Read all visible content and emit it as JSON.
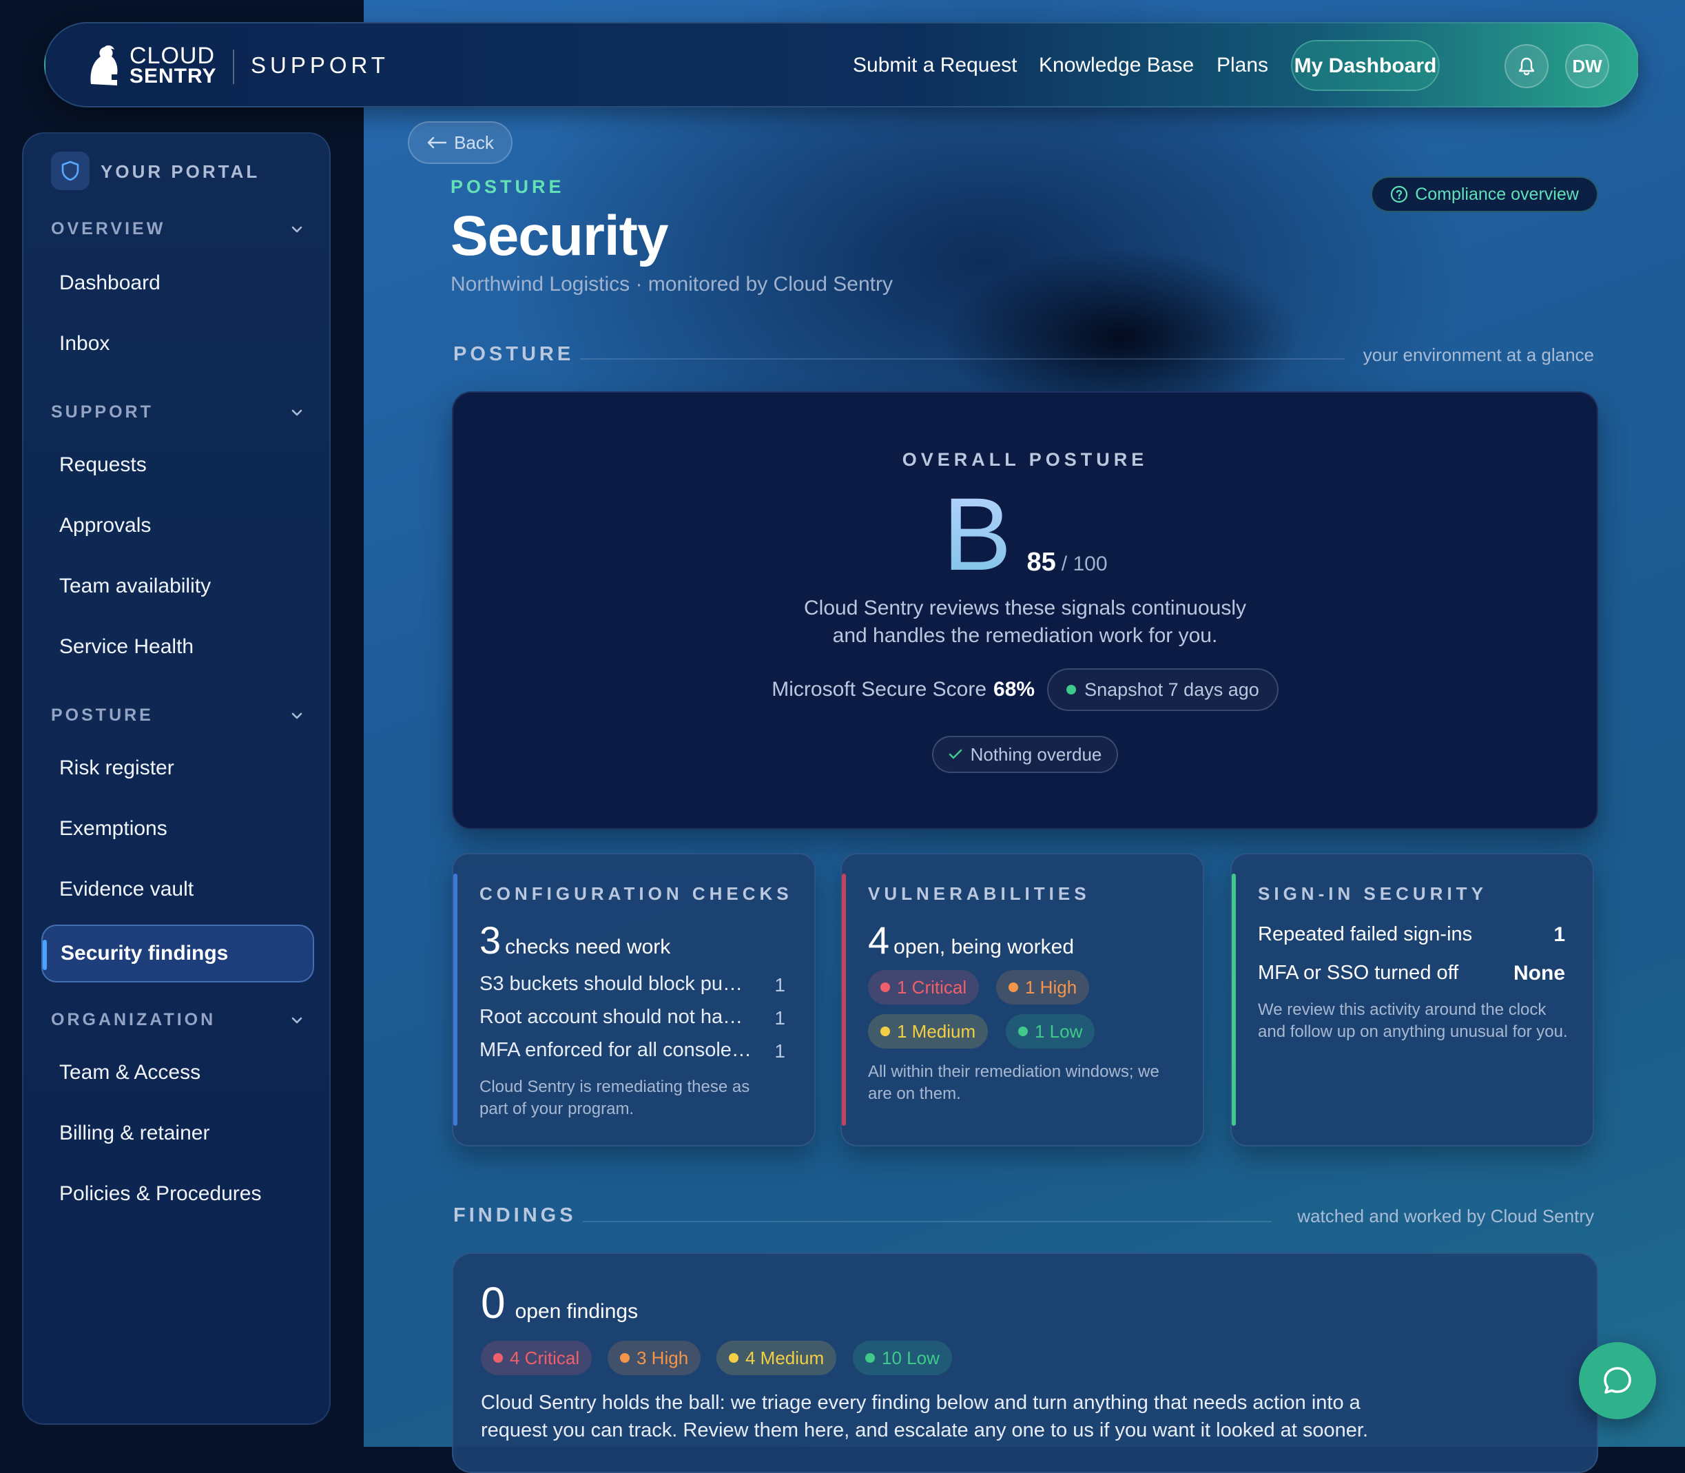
{
  "brand": {
    "name_line1": "CLOUD",
    "name_line2": "SENTRY",
    "product": "SUPPORT"
  },
  "topnav": {
    "links": [
      "Submit a Request",
      "Knowledge Base",
      "Plans"
    ],
    "dashboard_label": "My Dashboard",
    "avatar_initials": "DW"
  },
  "sidebar": {
    "portal_label": "YOUR PORTAL",
    "groups": [
      {
        "title": "OVERVIEW",
        "items": [
          "Dashboard",
          "Inbox"
        ]
      },
      {
        "title": "SUPPORT",
        "items": [
          "Requests",
          "Approvals",
          "Team availability",
          "Service Health"
        ]
      },
      {
        "title": "POSTURE",
        "items": [
          "Risk register",
          "Exemptions",
          "Evidence vault",
          "Security findings"
        ]
      },
      {
        "title": "ORGANIZATION",
        "items": [
          "Team & Access",
          "Billing & retainer",
          "Policies & Procedures"
        ]
      }
    ],
    "active_item": "Security findings"
  },
  "page": {
    "back_label": "Back",
    "eyebrow": "POSTURE",
    "title": "Security",
    "subtitle": "Northwind Logistics · monitored by Cloud Sentry",
    "compliance_label": "Compliance overview"
  },
  "posture_section": {
    "title": "POSTURE",
    "note": "your environment at a glance"
  },
  "overall": {
    "label": "OVERALL POSTURE",
    "grade": "B",
    "score": "85",
    "score_max": "/ 100",
    "desc_line1": "Cloud Sentry reviews these signals continuously",
    "desc_line2": "and handles the remediation work for you.",
    "secure_score_label": "Microsoft Secure Score",
    "secure_score_value": "68%",
    "snapshot": "Snapshot 7 days ago",
    "overdue": "Nothing overdue"
  },
  "config_checks": {
    "title": "CONFIGURATION CHECKS",
    "count": "3",
    "count_text": "checks need work",
    "rows": [
      {
        "label": "S3 buckets should block pu…",
        "count": "1"
      },
      {
        "label": "Root account should not ha…",
        "count": "1"
      },
      {
        "label": "MFA enforced for all console…",
        "count": "1"
      }
    ],
    "note": "Cloud Sentry is remediating these as part of your program."
  },
  "vulnerabilities": {
    "title": "VULNERABILITIES",
    "count": "4",
    "count_text": "open, being worked",
    "tags": [
      "1 Critical",
      "1 High",
      "1 Medium",
      "1 Low"
    ],
    "note": "All within their remediation windows; we are on them."
  },
  "signin": {
    "title": "SIGN-IN SECURITY",
    "rows": [
      {
        "label": "Repeated failed sign-ins",
        "value": "1"
      },
      {
        "label": "MFA or SSO turned off",
        "value": "None"
      }
    ],
    "note": "We review this activity around the clock and follow up on anything unusual for you."
  },
  "findings_section": {
    "title": "FINDINGS",
    "note": "watched and worked by Cloud Sentry"
  },
  "findings": {
    "count": "0",
    "count_text": "open findings",
    "tags": [
      "4 Critical",
      "3 High",
      "4 Medium",
      "10 Low"
    ],
    "body_line1": "Cloud Sentry holds the ball: we triage every finding below and turn anything that needs action into a",
    "body_line2": "request you can track. Review them here, and escalate any one to us if you want it looked at sooner."
  },
  "colors": {
    "critical": "#f0606a",
    "high": "#f5954a",
    "medium": "#f2cf45",
    "low": "#3fc98a",
    "accent": "#5fe0b8",
    "brand_green": "#2fb28c"
  }
}
